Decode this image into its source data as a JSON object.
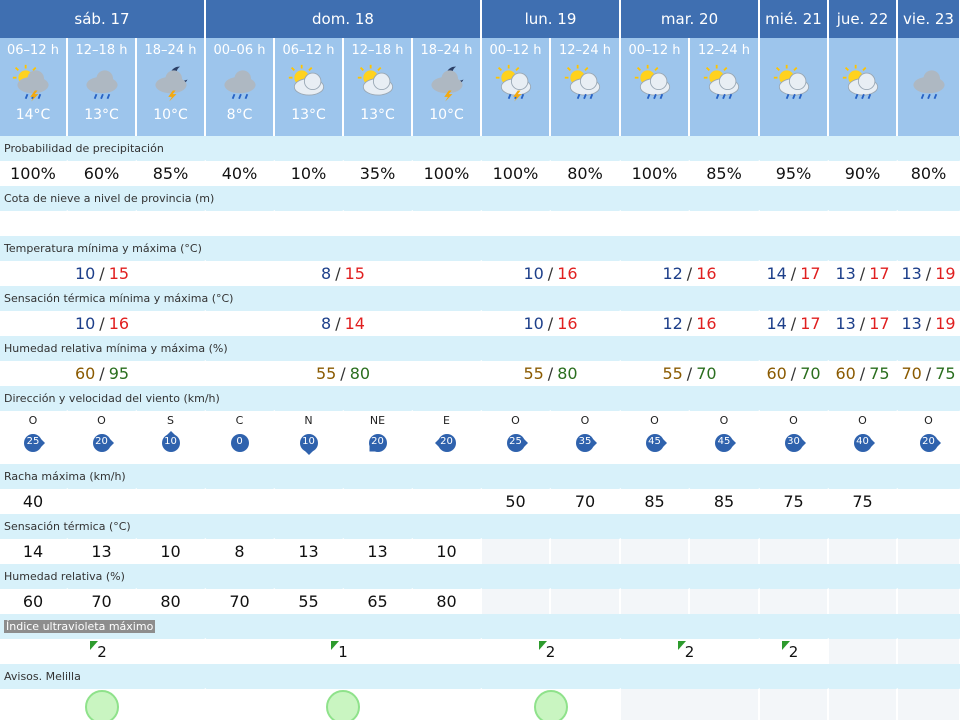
{
  "days": [
    {
      "label": "sáb. 17"
    },
    {
      "label": "dom. 18"
    },
    {
      "label": "lun. 19"
    },
    {
      "label": "mar. 20"
    },
    {
      "label": "mié. 21"
    },
    {
      "label": "jue. 22"
    },
    {
      "label": "vie. 23"
    }
  ],
  "periods": [
    {
      "label": "06–12 h",
      "temp": "14°C",
      "icon": "storm-cloud-icon"
    },
    {
      "label": "12–18 h",
      "temp": "13°C",
      "icon": "rain-cloud-icon"
    },
    {
      "label": "18–24 h",
      "temp": "10°C",
      "icon": "night-storm-icon"
    },
    {
      "label": "00–06 h",
      "temp": "8°C",
      "icon": "rain-cloud-icon"
    },
    {
      "label": "06–12 h",
      "temp": "13°C",
      "icon": "partly-cloudy-icon"
    },
    {
      "label": "12–18 h",
      "temp": "13°C",
      "icon": "partly-cloudy-icon"
    },
    {
      "label": "18–24 h",
      "temp": "10°C",
      "icon": "night-storm-icon"
    },
    {
      "label": "00–12 h",
      "temp": "",
      "icon": "sun-storm-icon"
    },
    {
      "label": "12–24 h",
      "temp": "",
      "icon": "sun-rain-icon"
    },
    {
      "label": "00–12 h",
      "temp": "",
      "icon": "sun-rain-icon"
    },
    {
      "label": "12–24 h",
      "temp": "",
      "icon": "sun-rain-icon"
    },
    {
      "label": "",
      "temp": "",
      "icon": "sun-rain-icon"
    },
    {
      "label": "",
      "temp": "",
      "icon": "sun-rain-icon"
    },
    {
      "label": "",
      "temp": "",
      "icon": "rain-cloud-icon"
    }
  ],
  "labels": {
    "precip": "Probabilidad de precipitación",
    "snow": "Cota de nieve a nivel de provincia (m)",
    "temp": "Temperatura mínima y máxima (°C)",
    "feels": "Sensación térmica mínima y máxima (°C)",
    "humidity": "Humedad relativa mínima y máxima (%)",
    "wind": "Dirección y velocidad del viento (km/h)",
    "gust": "Racha máxima (km/h)",
    "feels_now": "Sensación térmica (°C)",
    "humidity_now": "Humedad relativa (%)",
    "uv": "Índice ultravioleta máximo",
    "alerts": "Avisos. Melilla"
  },
  "precip": [
    "100%",
    "60%",
    "85%",
    "40%",
    "10%",
    "35%",
    "100%",
    "100%",
    "80%",
    "100%",
    "85%",
    "95%",
    "90%",
    "80%"
  ],
  "temp": [
    {
      "min": "10",
      "max": "15"
    },
    {
      "min": "8",
      "max": "15"
    },
    {
      "min": "10",
      "max": "16"
    },
    {
      "min": "12",
      "max": "16"
    },
    {
      "min": "14",
      "max": "17"
    },
    {
      "min": "13",
      "max": "17"
    },
    {
      "min": "13",
      "max": "19"
    }
  ],
  "feels": [
    {
      "min": "10",
      "max": "16"
    },
    {
      "min": "8",
      "max": "14"
    },
    {
      "min": "10",
      "max": "16"
    },
    {
      "min": "12",
      "max": "16"
    },
    {
      "min": "14",
      "max": "17"
    },
    {
      "min": "13",
      "max": "17"
    },
    {
      "min": "13",
      "max": "19"
    }
  ],
  "humidity": [
    {
      "min": "60",
      "max": "95"
    },
    {
      "min": "55",
      "max": "80"
    },
    {
      "min": "55",
      "max": "80"
    },
    {
      "min": "55",
      "max": "70"
    },
    {
      "min": "60",
      "max": "70"
    },
    {
      "min": "60",
      "max": "75"
    },
    {
      "min": "70",
      "max": "75"
    }
  ],
  "wind": [
    {
      "dir": "O",
      "speed": "25"
    },
    {
      "dir": "O",
      "speed": "20"
    },
    {
      "dir": "S",
      "speed": "10"
    },
    {
      "dir": "C",
      "speed": "0"
    },
    {
      "dir": "N",
      "speed": "10"
    },
    {
      "dir": "NE",
      "speed": "20"
    },
    {
      "dir": "E",
      "speed": "20"
    },
    {
      "dir": "O",
      "speed": "25"
    },
    {
      "dir": "O",
      "speed": "35"
    },
    {
      "dir": "O",
      "speed": "45"
    },
    {
      "dir": "O",
      "speed": "45"
    },
    {
      "dir": "O",
      "speed": "30"
    },
    {
      "dir": "O",
      "speed": "40"
    },
    {
      "dir": "O",
      "speed": "20"
    }
  ],
  "gust": [
    "40",
    "",
    "",
    "",
    "",
    "",
    "",
    "50",
    "70",
    "85",
    "85",
    "75",
    "75",
    ""
  ],
  "feels_now": [
    "14",
    "13",
    "10",
    "8",
    "13",
    "13",
    "10",
    "",
    "",
    "",
    "",
    "",
    "",
    ""
  ],
  "humidity_now": [
    "60",
    "70",
    "80",
    "70",
    "55",
    "65",
    "80",
    "",
    "",
    "",
    "",
    "",
    "",
    ""
  ],
  "uv": [
    "2",
    "1",
    "2",
    "2",
    "2",
    "",
    ""
  ],
  "colors": {
    "header": "#3f6fb1",
    "period": "#9dc5ec",
    "label_bg": "#d8f1fa",
    "temp_max": "#e01f1f",
    "temp_min": "#1d3f8a",
    "alert_green": "#c9f5c1",
    "wind_circle": "#2f62ad"
  }
}
